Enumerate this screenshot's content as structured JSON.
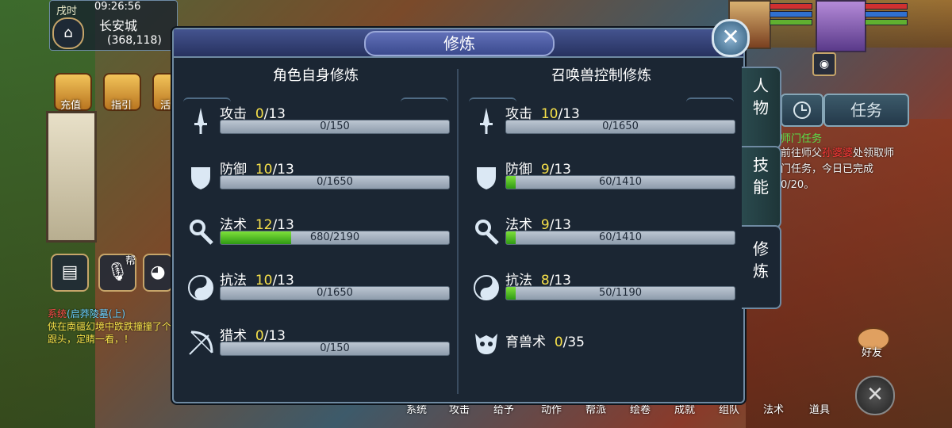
{
  "status": {
    "time_label": "戌时",
    "clock": "09:26:56",
    "city": "长安城",
    "coords": "(368,118)"
  },
  "left_shortcuts": [
    {
      "label": "充值",
      "icon": "recharge-icon"
    },
    {
      "label": "指引",
      "icon": "guide-icon"
    },
    {
      "label": "活",
      "icon": "activity-icon"
    }
  ],
  "left_side": {
    "voice_label": "帮",
    "chat": [
      {
        "tag": "系统",
        "quest": "(启莽陵墓(上)",
        "text": "俠在南疆幻境中跌跌撞撞了个跟头，定睛一看，！"
      }
    ]
  },
  "panel": {
    "title": "修炼",
    "left": {
      "title": "角色自身修炼",
      "rows": [
        {
          "name": "攻击",
          "level": "0",
          "max": "/13",
          "exp": "0/150",
          "fill": 0.0,
          "icon": "sword-icon"
        },
        {
          "name": "防御",
          "level": "10",
          "max": "/13",
          "exp": "0/1650",
          "fill": 0.0,
          "icon": "shield-icon"
        },
        {
          "name": "法术",
          "level": "12",
          "max": "/13",
          "exp": "680/2190",
          "fill": 0.31,
          "icon": "magic-staff-icon"
        },
        {
          "name": "抗法",
          "level": "10",
          "max": "/13",
          "exp": "0/1650",
          "fill": 0.0,
          "icon": "yin-yang-icon"
        },
        {
          "name": "猎术",
          "level": "0",
          "max": "/13",
          "exp": "0/150",
          "fill": 0.0,
          "icon": "bow-icon"
        }
      ]
    },
    "right": {
      "title": "召唤兽控制修炼",
      "rows": [
        {
          "name": "攻击",
          "level": "10",
          "max": "/13",
          "exp": "0/1650",
          "fill": 0.0,
          "icon": "sword-icon"
        },
        {
          "name": "防御",
          "level": "9",
          "max": "/13",
          "exp": "60/1410",
          "fill": 0.04,
          "icon": "shield-icon"
        },
        {
          "name": "法术",
          "level": "9",
          "max": "/13",
          "exp": "60/1410",
          "fill": 0.04,
          "icon": "magic-staff-icon"
        },
        {
          "name": "抗法",
          "level": "8",
          "max": "/13",
          "exp": "50/1190",
          "fill": 0.04,
          "icon": "yin-yang-icon"
        }
      ],
      "breeding": {
        "name": "育兽术",
        "level": "0",
        "max": "/35",
        "icon": "beast-skull-icon"
      }
    },
    "tabs": [
      {
        "label": "人\n物",
        "active": false
      },
      {
        "label": "技\n能",
        "active": false
      },
      {
        "label": "修\n炼",
        "active": true
      }
    ]
  },
  "right_hud": {
    "tasks_label": "任务",
    "task_title": "师门任务",
    "task_text_pre": "前往师父",
    "task_text_red": "孙婆婆",
    "task_text_post": "处领取师门任务，今日已完成0/20。",
    "friend_label": "好友"
  },
  "bottom_menu": [
    "系统",
    "攻击",
    "给予",
    "动作",
    "帮派",
    "绘卷",
    "成就",
    "组队",
    "法术",
    "道具"
  ],
  "colors": {
    "accent_level": "#f6e04a",
    "progress_fill": "#4fc020",
    "panel_bg": "#1b2633"
  }
}
